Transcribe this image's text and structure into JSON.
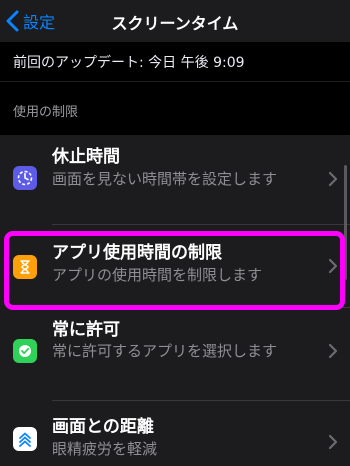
{
  "navbar": {
    "back_label": "設定",
    "title": "スクリーンタイム"
  },
  "update": {
    "text": "前回のアップデート: 今日 午後 9:09"
  },
  "section": {
    "header": "使用の制限"
  },
  "rows": [
    {
      "title": "休止時間",
      "subtitle": "画面を見ない時間帯を設定します",
      "icon": "downtime-icon",
      "color": "#5e5ce6"
    },
    {
      "title": "アプリ使用時間の制限",
      "subtitle": "アプリの使用時間を制限します",
      "icon": "hourglass-icon",
      "color": "#ff9f0a"
    },
    {
      "title": "常に許可",
      "subtitle": "常に許可するアプリを選択します",
      "icon": "always-allowed-icon",
      "color": "#30d158"
    },
    {
      "title": "画面との距離",
      "subtitle": "眼精疲労を軽減",
      "icon": "screen-distance-icon",
      "color": "#ffffff"
    }
  ],
  "colors": {
    "accent": "#0a84ff",
    "highlight": "#ff00ff"
  }
}
